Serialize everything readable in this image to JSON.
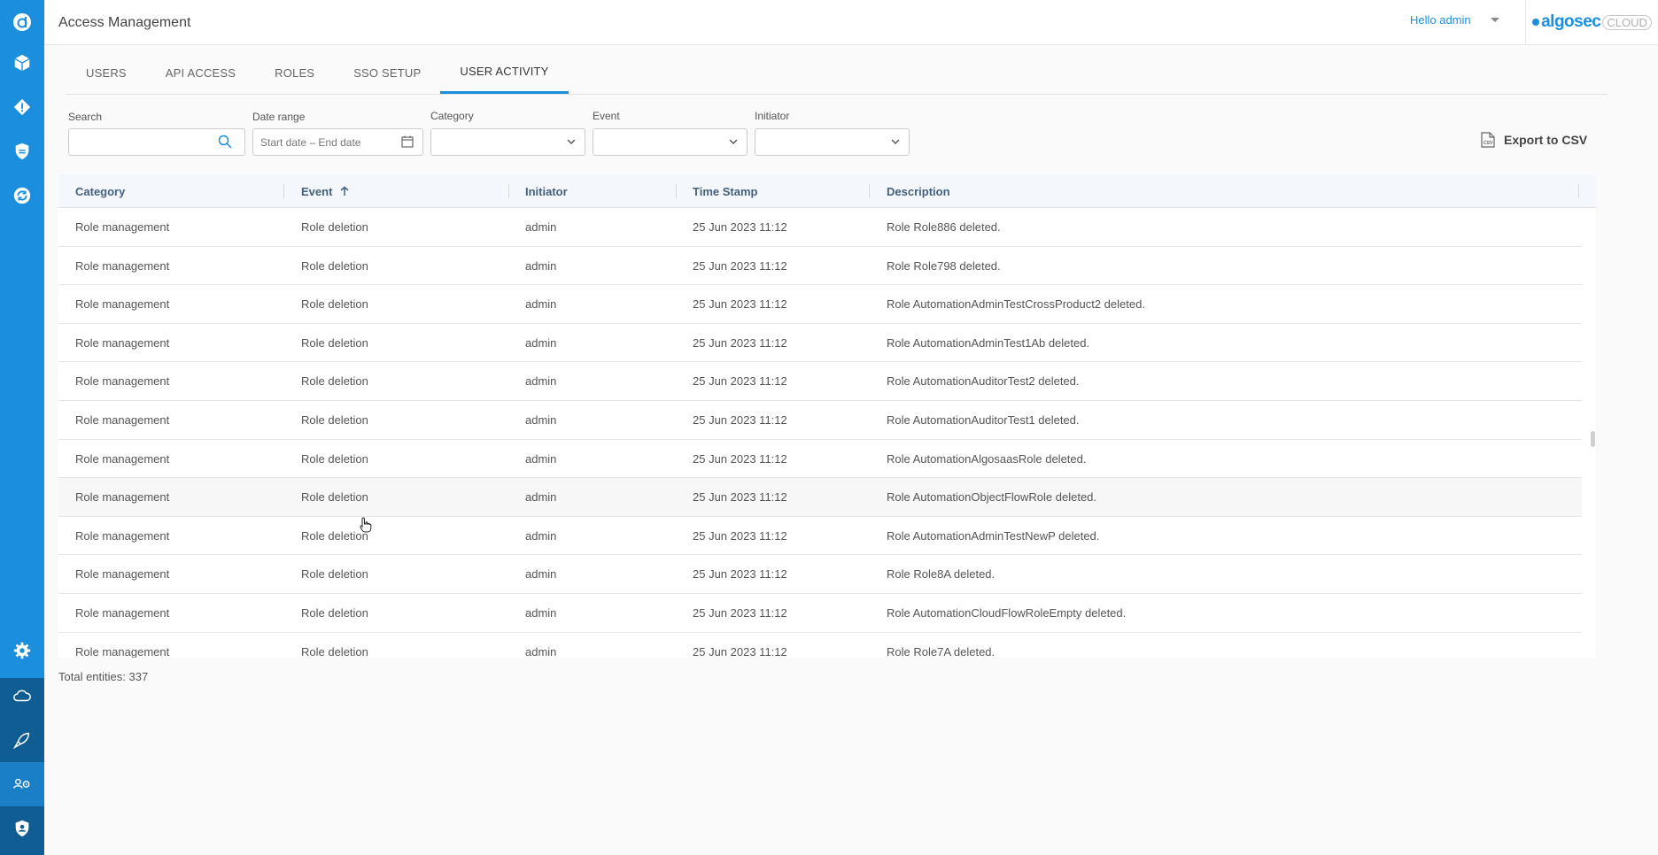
{
  "app": {
    "page_title": "Access Management",
    "user_greeting": "Hello admin",
    "brand_name": "algosec",
    "brand_suffix": "CLOUD",
    "accent_color": "#1c8ede"
  },
  "sidebar": {
    "top_icons": [
      "logo-icon",
      "cube-icon",
      "alert-diamond-icon",
      "shield-icon",
      "sync-icon"
    ],
    "bottom_icons": [
      "settings-icon",
      "cloud-icon",
      "rocket-icon",
      "users-gear-icon",
      "user-shield-icon"
    ],
    "active": "users-gear-icon"
  },
  "tabs": [
    {
      "label": "USERS",
      "active": false
    },
    {
      "label": "API ACCESS",
      "active": false
    },
    {
      "label": "ROLES",
      "active": false
    },
    {
      "label": "SSO SETUP",
      "active": false
    },
    {
      "label": "USER ACTIVITY",
      "active": true
    }
  ],
  "filters": {
    "search_label": "Search",
    "search_value": "",
    "date_label": "Date range",
    "date_start_placeholder": "Start date",
    "date_sep": "–",
    "date_end_placeholder": "End date",
    "category_label": "Category",
    "event_label": "Event",
    "initiator_label": "Initiator",
    "export_label": "Export to CSV"
  },
  "table": {
    "columns": [
      "Category",
      "Event",
      "Initiator",
      "Time Stamp",
      "Description"
    ],
    "sorted_column": "Event",
    "sort_direction": "ascending",
    "rows": [
      [
        "Role management",
        "Role deletion",
        "admin",
        "25 Jun 2023 11:12",
        "Role Role886 deleted."
      ],
      [
        "Role management",
        "Role deletion",
        "admin",
        "25 Jun 2023 11:12",
        "Role Role798 deleted."
      ],
      [
        "Role management",
        "Role deletion",
        "admin",
        "25 Jun 2023 11:12",
        "Role AutomationAdminTestCrossProduct2 deleted."
      ],
      [
        "Role management",
        "Role deletion",
        "admin",
        "25 Jun 2023 11:12",
        "Role AutomationAdminTest1Ab deleted."
      ],
      [
        "Role management",
        "Role deletion",
        "admin",
        "25 Jun 2023 11:12",
        "Role AutomationAuditorTest2 deleted."
      ],
      [
        "Role management",
        "Role deletion",
        "admin",
        "25 Jun 2023 11:12",
        "Role AutomationAuditorTest1 deleted."
      ],
      [
        "Role management",
        "Role deletion",
        "admin",
        "25 Jun 2023 11:12",
        "Role AutomationAlgosaasRole deleted."
      ],
      [
        "Role management",
        "Role deletion",
        "admin",
        "25 Jun 2023 11:12",
        "Role AutomationObjectFlowRole deleted."
      ],
      [
        "Role management",
        "Role deletion",
        "admin",
        "25 Jun 2023 11:12",
        "Role AutomationAdminTestNewP deleted."
      ],
      [
        "Role management",
        "Role deletion",
        "admin",
        "25 Jun 2023 11:12",
        "Role Role8A deleted."
      ],
      [
        "Role management",
        "Role deletion",
        "admin",
        "25 Jun 2023 11:12",
        "Role AutomationCloudFlowRoleEmpty deleted."
      ],
      [
        "Role management",
        "Role deletion",
        "admin",
        "25 Jun 2023 11:12",
        "Role Role7A deleted."
      ]
    ],
    "hovered_row": 7,
    "total_text": "Total entities: 337"
  }
}
